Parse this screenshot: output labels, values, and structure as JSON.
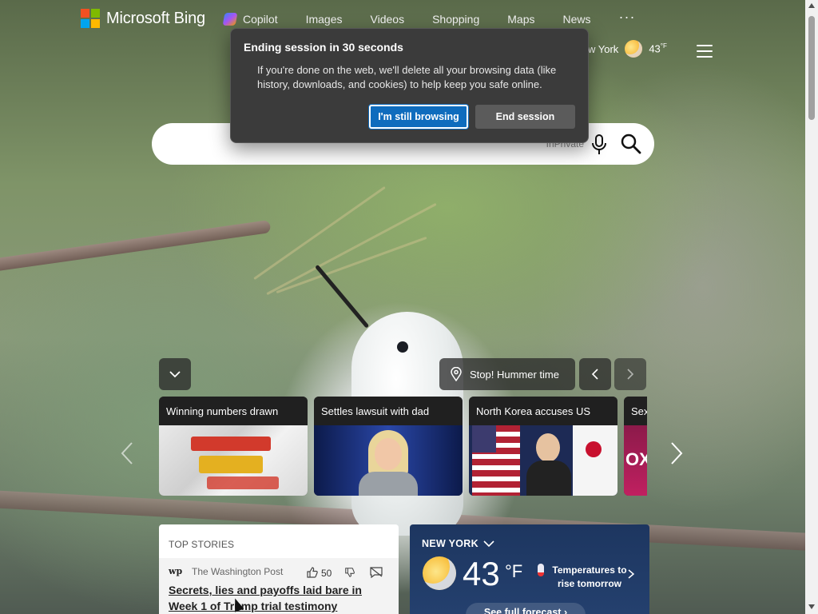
{
  "brand": {
    "name": "Microsoft Bing",
    "colors": {
      "red": "#f25022",
      "green": "#7fba00",
      "blue": "#00a4ef",
      "yellow": "#ffb900"
    }
  },
  "nav": {
    "items": [
      {
        "label": "Copilot",
        "icon": "copilot-icon"
      },
      {
        "label": "Images"
      },
      {
        "label": "Videos"
      },
      {
        "label": "Shopping"
      },
      {
        "label": "Maps"
      },
      {
        "label": "News"
      }
    ],
    "more": "···"
  },
  "header_weather": {
    "location": "w York",
    "temp": "43",
    "unit": "°F",
    "icon": "moon-partly-cloudy-icon"
  },
  "search": {
    "placeholder": "",
    "mode_label": "InPrivate"
  },
  "dialog": {
    "title": "Ending session in 30 seconds",
    "body": "If you're done on the web, we'll delete all your browsing data (like history, downloads, and cookies) to help keep you safe online.",
    "primary_label": "I'm still browsing",
    "secondary_label": "End session",
    "accent": "#0f6cbd"
  },
  "image_info": {
    "caption": "Stop! Hummer time"
  },
  "carousel": {
    "cards": [
      {
        "title": "Winning numbers drawn",
        "image": "mega-millions-tickets"
      },
      {
        "title": "Settles lawsuit with dad",
        "image": "woman-blonde-portrait"
      },
      {
        "title": "North Korea accuses US",
        "image": "official-flags-press"
      },
      {
        "title": "Sex",
        "image": "fox-studio"
      }
    ]
  },
  "top_stories": {
    "heading": "TOP STORIES",
    "item": {
      "source_logo": "wp",
      "source": "The Washington Post",
      "likes": "50",
      "headline": "Secrets, lies and payoffs laid bare in Week 1 of Trump trial testimony"
    }
  },
  "weather_card": {
    "location": "NEW YORK",
    "temp": "43",
    "unit": "°F",
    "trend": "Temperatures to rise tomorrow",
    "forecast_label": "See full forecast"
  }
}
